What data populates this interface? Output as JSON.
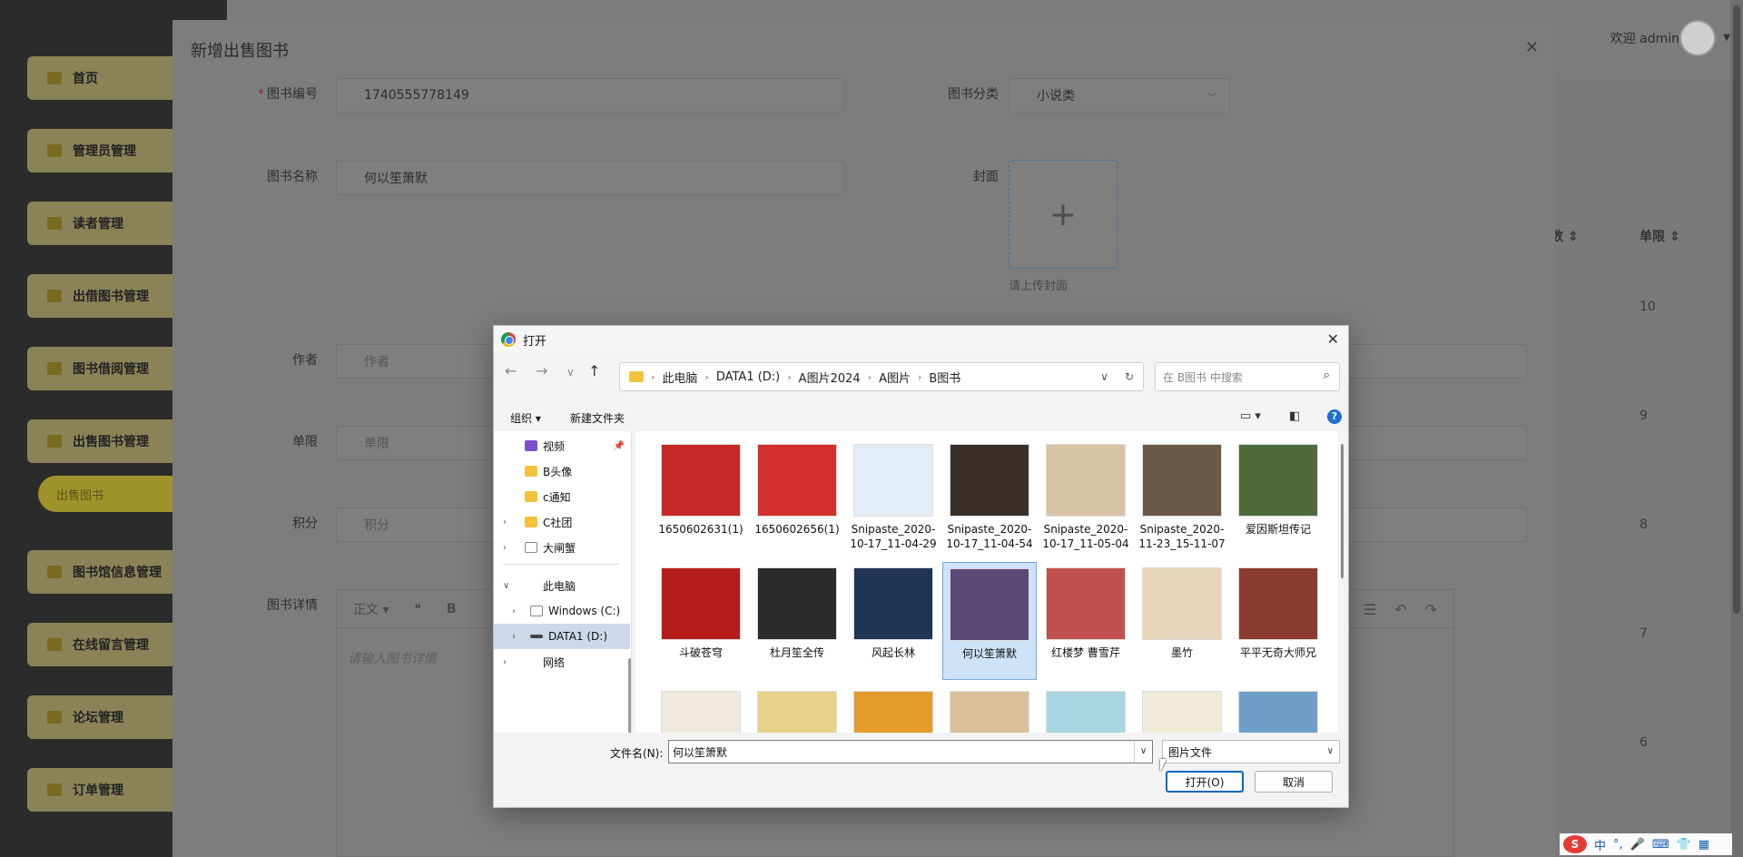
{
  "sidebar": {
    "items": [
      {
        "label": "首页"
      },
      {
        "label": "管理员管理"
      },
      {
        "label": "读者管理"
      },
      {
        "label": "出借图书管理"
      },
      {
        "label": "图书借阅管理"
      },
      {
        "label": "出售图书管理"
      },
      {
        "label": "图书馆信息管理"
      },
      {
        "label": "在线留言管理"
      },
      {
        "label": "论坛管理"
      },
      {
        "label": "订单管理"
      }
    ],
    "sub_item": "出售图书"
  },
  "header": {
    "welcome": "欢迎 admin"
  },
  "table": {
    "headers": [
      "数",
      "单限"
    ],
    "values": [
      "10",
      "9",
      "8",
      "7",
      "6"
    ]
  },
  "modal": {
    "title": "新增出售图书",
    "fields": {
      "book_no": {
        "label": "图书编号",
        "value": "1740555778149"
      },
      "category": {
        "label": "图书分类",
        "value": "小说类"
      },
      "book_name": {
        "label": "图书名称",
        "value": "何以笙箫默"
      },
      "cover": {
        "label": "封面",
        "hint": "请上传封面"
      },
      "author": {
        "label": "作者",
        "placeholder": "作者"
      },
      "limit": {
        "label": "单限",
        "placeholder": "单限"
      },
      "points": {
        "label": "积分",
        "placeholder": "积分"
      },
      "detail": {
        "label": "图书详情",
        "placeholder": "请输入图书详情",
        "toolbar": [
          "正文",
          "❝",
          "B"
        ]
      }
    }
  },
  "dialog": {
    "title": "打开",
    "breadcrumb": [
      "此电脑",
      "DATA1 (D:)",
      "A图片2024",
      "A图片",
      "B图书"
    ],
    "search_placeholder": "在 B图书 中搜索",
    "commands": {
      "organize": "组织",
      "new_folder": "新建文件夹"
    },
    "tree": [
      {
        "label": "视频"
      },
      {
        "label": "B头像"
      },
      {
        "label": "c通知"
      },
      {
        "label": "C社团"
      },
      {
        "label": "大闸蟹"
      },
      {
        "label": "此电脑"
      },
      {
        "label": "Windows (C:)"
      },
      {
        "label": "DATA1 (D:)"
      },
      {
        "label": "网络"
      }
    ],
    "files": [
      {
        "name": "1650602631(1)",
        "color": "#c62828"
      },
      {
        "name": "1650602656(1)",
        "color": "#d32f2f"
      },
      {
        "name": "Snipaste_2020-10-17_11-04-29",
        "color": "#e3edf7"
      },
      {
        "name": "Snipaste_2020-10-17_11-04-54",
        "color": "#3a2f28"
      },
      {
        "name": "Snipaste_2020-10-17_11-05-04",
        "color": "#d8c3a5"
      },
      {
        "name": "Snipaste_2020-11-23_15-11-07",
        "color": "#6b5a48"
      },
      {
        "name": "爱因斯坦传记",
        "color": "#4f6b3a"
      },
      {
        "name": "斗破苍穹",
        "color": "#b71c1c"
      },
      {
        "name": "杜月笙全传",
        "color": "#2b2b2b"
      },
      {
        "name": "风起长林",
        "color": "#1f3556"
      },
      {
        "name": "何以笙箫默",
        "color": "#5a4a78"
      },
      {
        "name": "红楼梦  曹雪芹",
        "color": "#c0504d"
      },
      {
        "name": "墨竹",
        "color": "#e6d5b8"
      },
      {
        "name": "平平无奇大师兄",
        "color": "#8b3a2f"
      },
      {
        "name": "",
        "color": "#efe9dd"
      },
      {
        "name": "",
        "color": "#e8d28a"
      },
      {
        "name": "",
        "color": "#e39b2b"
      },
      {
        "name": "",
        "color": "#d9c09a"
      },
      {
        "name": "",
        "color": "#a8d5e2"
      },
      {
        "name": "",
        "color": "#f0ead8"
      },
      {
        "name": "",
        "color": "#6f9fc8"
      }
    ],
    "filename_label": "文件名(N):",
    "filename_value": "何以笙箫默",
    "filetype": "图片文件",
    "open_button": "打开(O)",
    "cancel_button": "取消"
  }
}
